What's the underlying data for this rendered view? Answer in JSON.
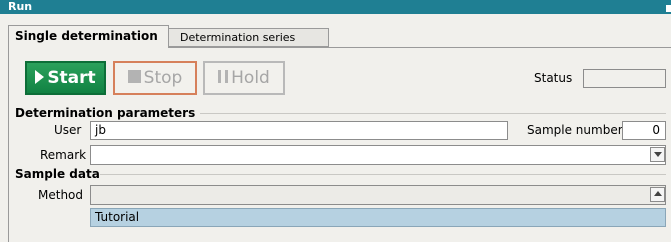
{
  "window": {
    "title": "Run"
  },
  "tabs": [
    {
      "label": "Single determination",
      "active": true
    },
    {
      "label": "Determination series",
      "active": false
    }
  ],
  "controls": {
    "start_label": "Start",
    "stop_label": "Stop",
    "hold_label": "Hold",
    "status_label": "Status",
    "status_value": ""
  },
  "determination": {
    "section_title": "Determination parameters",
    "user_label": "User",
    "user_value": "jb",
    "sample_number_label": "Sample number",
    "sample_number_value": "0",
    "remark_label": "Remark",
    "remark_value": ""
  },
  "sample": {
    "section_title": "Sample data",
    "method_label": "Method",
    "method_value": "",
    "method_options": [
      "Tutorial"
    ]
  },
  "colors": {
    "title_bar": "#1f7f93",
    "start_button": "#118243",
    "stop_border": "#d6805b",
    "list_highlight": "#b6d1e1"
  }
}
